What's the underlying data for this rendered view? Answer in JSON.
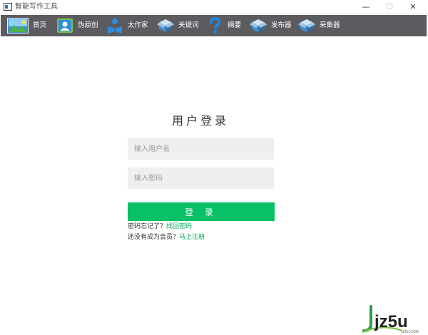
{
  "window": {
    "title": "智能写作工具",
    "minimize_glyph": "—",
    "maximize_glyph": "☐",
    "close_glyph": "✕"
  },
  "toolbar": {
    "items": [
      {
        "label": "首页",
        "icon": "landscape-icon"
      },
      {
        "label": "伪原创",
        "icon": "contacts-icon"
      },
      {
        "label": "太作家",
        "icon": "reader-icon"
      },
      {
        "label": "关键词",
        "icon": "box-icon"
      },
      {
        "label": "摘要",
        "icon": "question-icon"
      },
      {
        "label": "发布器",
        "icon": "box-icon"
      },
      {
        "label": "采集器",
        "icon": "box-icon"
      }
    ]
  },
  "login": {
    "title": "用户登录",
    "username_placeholder": "输入用户名",
    "password_placeholder": "输入密码",
    "button_label": "登 录",
    "forgot_text": "密码忘记了？",
    "forgot_link": "找回密码",
    "register_text": "还没有成为会员？",
    "register_link": "马上注册"
  },
  "watermark": {
    "text": "jz5u",
    "subtext": "JZ5U.COM"
  },
  "colors": {
    "toolbar_bg": "#5b5b60",
    "accent_green": "#08c066",
    "link_green": "#08a85a",
    "field_bg": "#efefef"
  }
}
